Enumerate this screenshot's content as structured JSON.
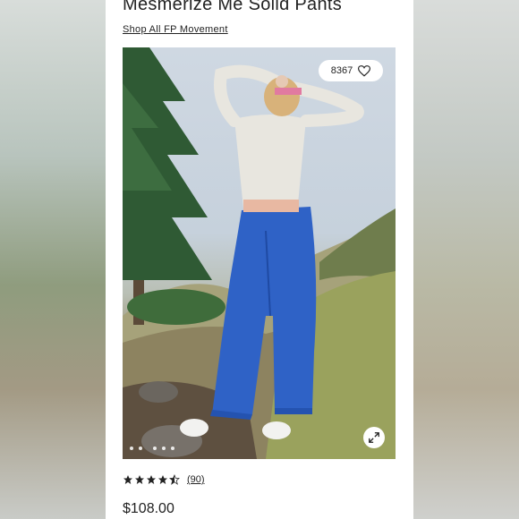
{
  "product": {
    "title": "Mesmerize Me Solid Pants",
    "collection_link": "Shop All FP Movement",
    "favorites_count": "8367",
    "rating": 4.5,
    "reviews_label": "(90)",
    "price": "$108.00"
  },
  "gallery": {
    "image_count": 5,
    "active_index": 0
  },
  "colors": {
    "pants": "#2f62c6",
    "background_white": "#ffffff",
    "text": "#222222"
  },
  "icons": {
    "favorite": "heart-icon",
    "expand": "expand-icon",
    "star": "star-icon"
  }
}
